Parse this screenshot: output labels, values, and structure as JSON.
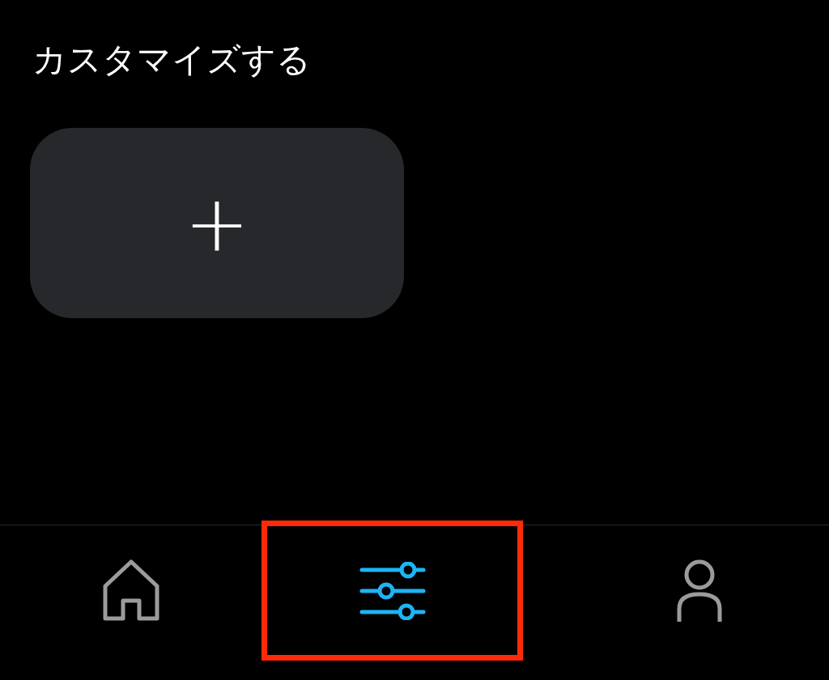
{
  "header": {
    "title": "カスタマイズする"
  },
  "add_card": {
    "label": "+"
  },
  "tab_bar": [
    {
      "kind": "home",
      "selected": false,
      "highlighted": false
    },
    {
      "kind": "customize",
      "selected": true,
      "highlighted": true
    },
    {
      "kind": "profile",
      "selected": false,
      "highlighted": false
    }
  ]
}
